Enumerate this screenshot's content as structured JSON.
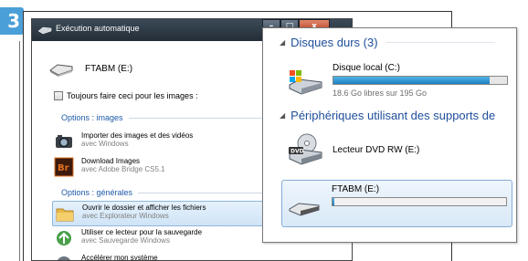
{
  "step_number": "3",
  "autoplay": {
    "title": "Exécution automatique",
    "device_label": "FTABM (E:)",
    "always_checkbox_label": "Toujours faire ceci pour les images :",
    "group_images": "Options : images",
    "group_general": "Options : générales",
    "options": [
      {
        "title": "Importer des images et des vidéos",
        "sub": "avec Windows"
      },
      {
        "title": "Download Images",
        "sub": "avec Adobe Bridge CS5.1"
      },
      {
        "title": "Ouvrir le dossier et afficher les fichiers",
        "sub": "avec Explorateur Windows"
      },
      {
        "title": "Utiliser ce lecteur pour la sauvegarde",
        "sub": "avec Sauvegarde Windows"
      },
      {
        "title": "Accélérer mon système",
        "sub": ""
      }
    ],
    "bridge_icon_text": "Br"
  },
  "computer": {
    "section_hdd": "Disques durs (3)",
    "drive_c_name": "Disque local (C:)",
    "drive_c_free": "18.6 Go libres sur 195 Go",
    "drive_c_used_fraction": 0.9,
    "section_removable": "Périphériques utilisant des supports de",
    "dvd_name": "Lecteur DVD RW (E:)",
    "dvd_badge": "DVD",
    "usb_name": "FTABM (E:)",
    "usb_used_fraction": 0.01
  },
  "colors": {
    "accent": "#4a9fd8",
    "header_blue": "#1e4e9a",
    "bar_fill": "#1e7fbf"
  }
}
